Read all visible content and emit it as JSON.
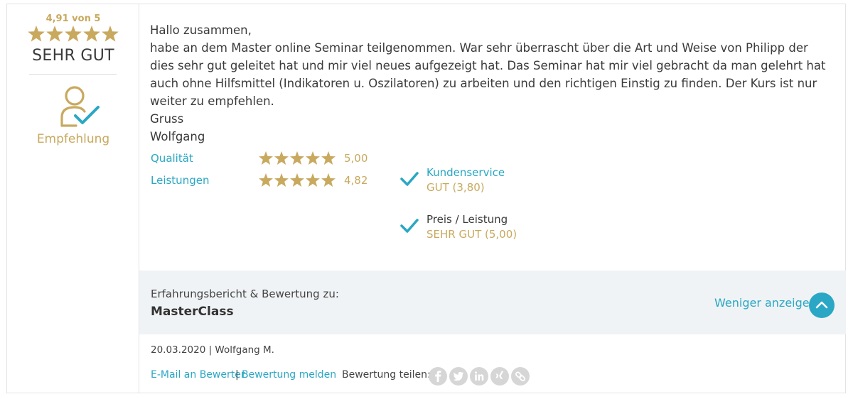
{
  "overall": {
    "score_text": "4,91 von 5",
    "stars": 5,
    "label": "SEHR GUT",
    "recommendation": "Empfehlung"
  },
  "review": {
    "lines": [
      "Hallo zusammen,",
      "habe an dem Master online Seminar teilgenommen. War sehr überrascht über die Art und Weise von Philipp der dies sehr gut geleitet hat und mir viel neues aufgezeigt hat. Das Seminar hat mir viel gebracht da man gelehrt hat auch ohne Hilfsmittel (Indikatoren u. Oszilatoren) zu arbeiten und den richtigen Einstig zu finden. Der Kurs ist nur weiter zu empfehlen.",
      "Gruss",
      "Wolfgang"
    ]
  },
  "criteria": [
    {
      "label": "Qualität",
      "stars": 5,
      "value": "5,00"
    },
    {
      "label": "Leistungen",
      "stars": 5,
      "value": "4,82"
    }
  ],
  "checks": [
    {
      "title": "Kundenservice",
      "value": "GUT (3,80)",
      "title_color": "#2aa7c4"
    },
    {
      "title": "Preis / Leistung",
      "value": "SEHR GUT (5,00)",
      "title_color": "#3a3a3a"
    }
  ],
  "footer": {
    "band_label": "Erfahrungsbericht & Bewertung zu:",
    "product": "MasterClass",
    "toggle_label": "Weniger anzeigen",
    "meta": "20.03.2020 | Wolfgang M.",
    "email_link": "E-Mail an Bewerter",
    "separator": "|",
    "report_link": "Bewertung melden",
    "share_label": "Bewertung teilen:",
    "share_icons": [
      "facebook-icon",
      "twitter-icon",
      "linkedin-icon",
      "xing-icon",
      "link-icon"
    ]
  },
  "colors": {
    "gold": "#c8a95e",
    "teal": "#2aa7c4",
    "band": "#f0f3f5"
  }
}
